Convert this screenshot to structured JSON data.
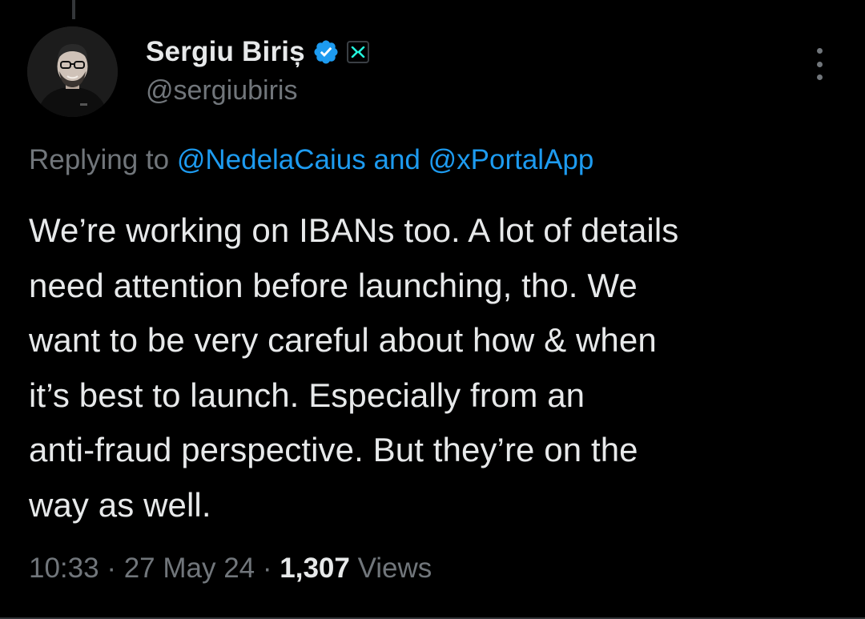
{
  "author": {
    "display_name": "Sergiu Biriș",
    "handle": "@sergiubiris",
    "avatar_icon": "profile-photo",
    "verified_icon": "verified-badge-icon",
    "affiliate_icon": "x-logo-affiliate-icon"
  },
  "reply_context": {
    "prefix": "Replying to ",
    "mention_1": "@NedelaCaius",
    "connector": " and ",
    "mention_2": "@xPortalApp"
  },
  "tweet": {
    "text": "We’re working on IBANs too. A lot of details\nneed attention before launching, tho. We\nwant to be very careful about how & when\nit’s best to launch. Especially from an\nanti-fraud perspective. But they’re on the\nway as well."
  },
  "meta": {
    "time": "10:33",
    "separator_1": " · ",
    "date": "27 May 24",
    "separator_2": " · ",
    "views_count": "1,307",
    "views_label": " Views"
  },
  "colors": {
    "background": "#000000",
    "text_primary": "#e7e9ea",
    "text_secondary": "#71767b",
    "accent": "#1d9bf0"
  }
}
